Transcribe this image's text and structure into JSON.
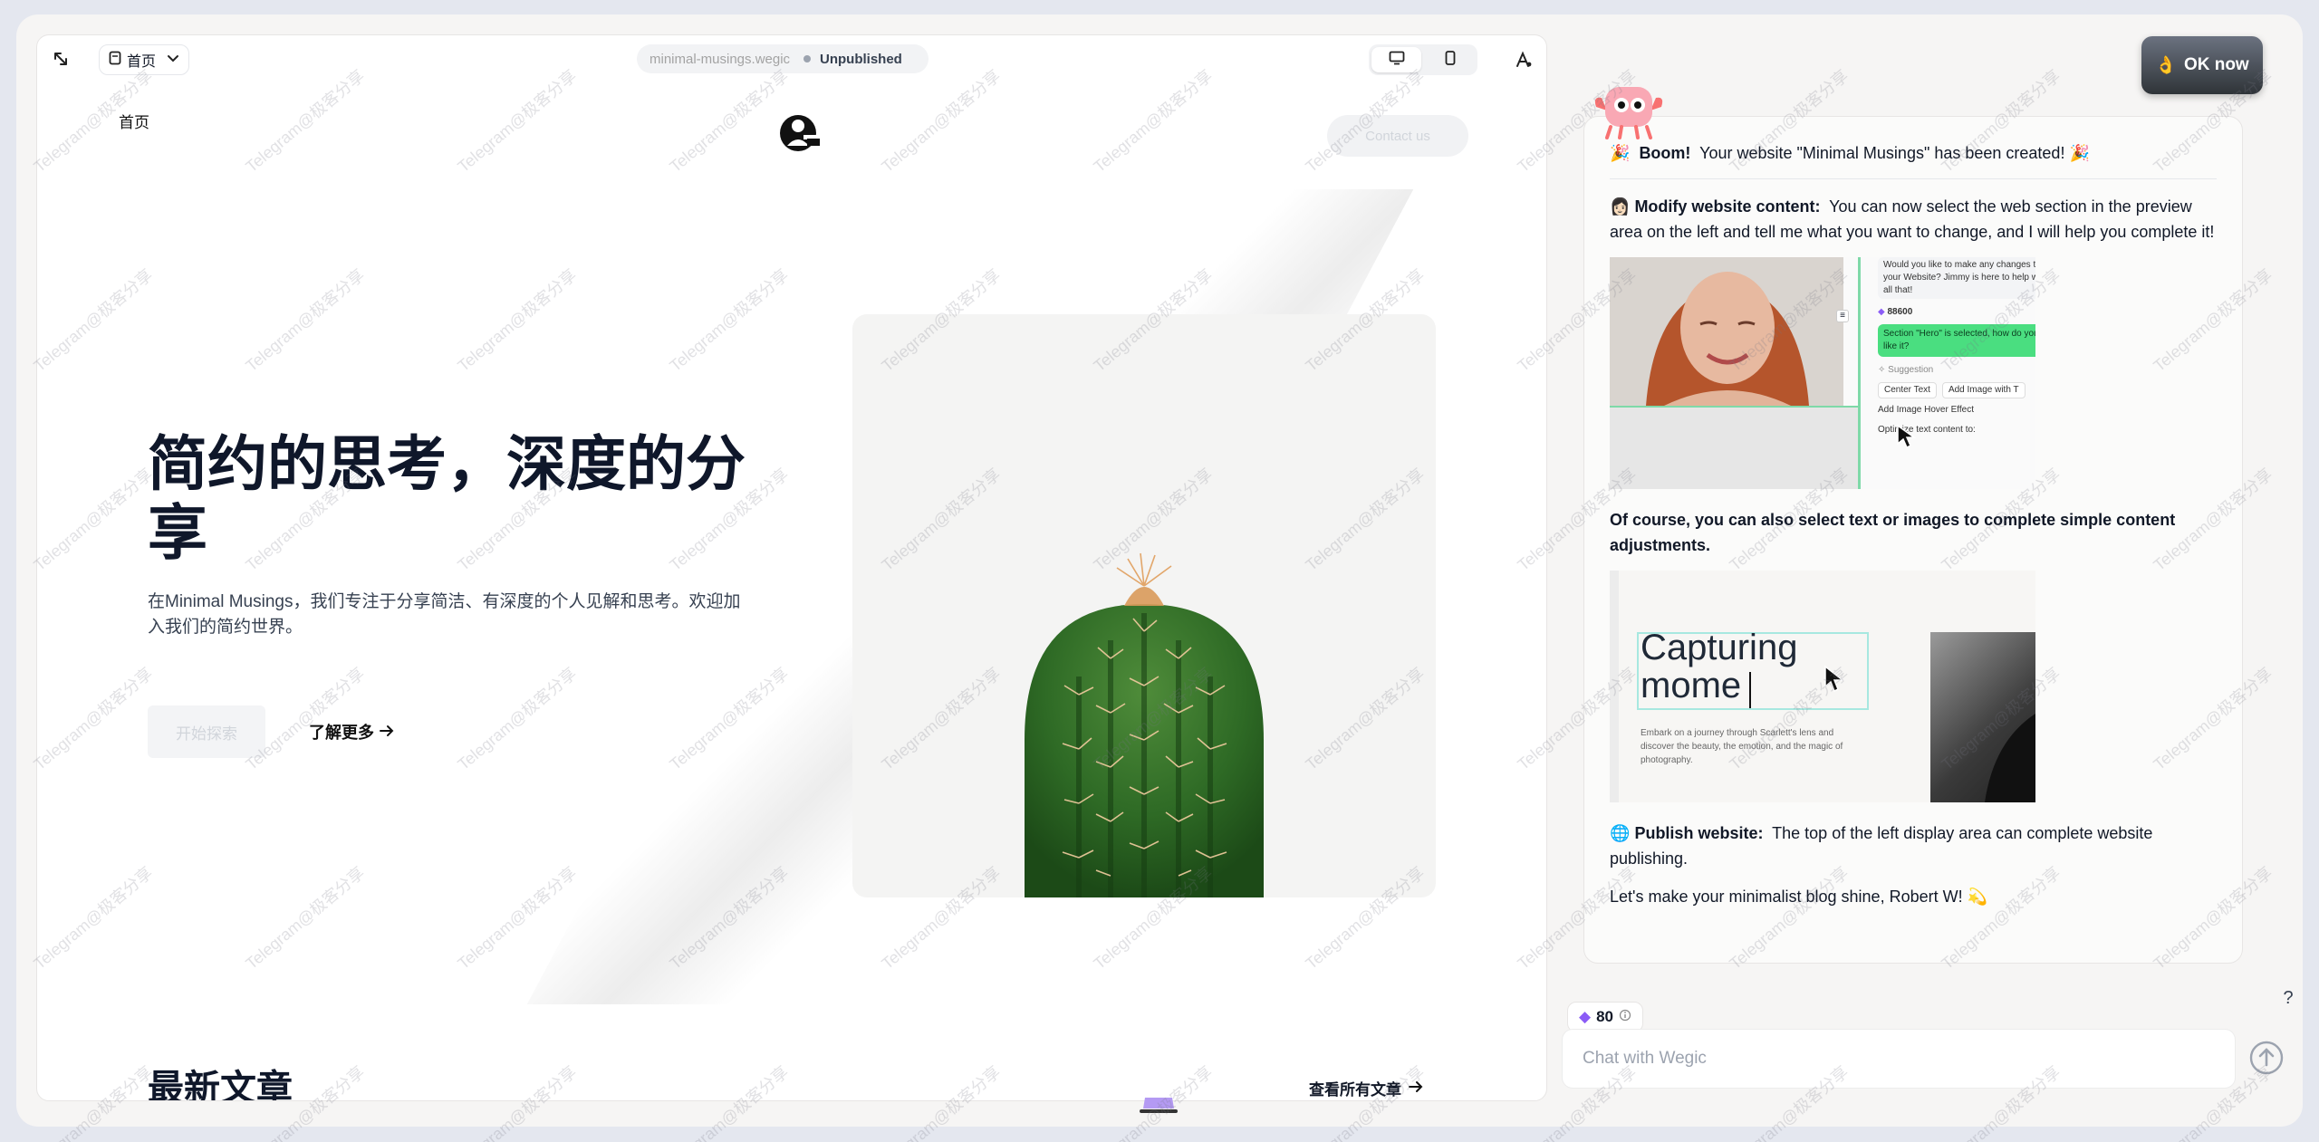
{
  "preview": {
    "page_select_label": "首页",
    "url": "minimal-musings.wegic",
    "status": "Unpublished"
  },
  "site": {
    "nav_home": "首页",
    "cta_label": "Contact us",
    "hero_title": "简约的思考，深度的分享",
    "hero_subtitle": "在Minimal Musings，我们专注于分享简洁、有深度的个人见解和思考。欢迎加入我们的简约世界。",
    "hero_start": "开始探索",
    "hero_more": "了解更多",
    "latest_title": "最新文章",
    "view_all": "查看所有文章"
  },
  "chat": {
    "ok_now": "OK now",
    "boom_bold": "Boom!",
    "boom_text": "Your website \"Minimal Musings\" has been created!",
    "modify_bold": "Modify website content:",
    "modify_text": "You can now select the web section in the preview area on the left and tell me what you want to change, and I will help you complete it!",
    "demo1": {
      "bubble_text": "Would you like to make any changes to your Website? Jimmy is here to help with all that!",
      "credits": "88600",
      "selected_text": "Section \"Hero\" is selected, how do you like it?",
      "suggestion_label": "Suggestion",
      "chips": [
        "Center Text",
        "Add Image with T",
        "Add Image Hover Effect",
        "Optimize text content to:"
      ]
    },
    "course_text": "Of course, you can also select text or images to complete simple content adjustments.",
    "demo2": {
      "heading": "Capturing mome",
      "paragraph": "Embark on a journey through Scarlett's lens and discover the beauty, the emotion, and the magic of photography."
    },
    "publish_bold": "Publish website:",
    "publish_text": "The top of the left display area can complete website publishing.",
    "closing_text": "Let's make your minimalist blog shine, Robert W!",
    "credits": "80",
    "input_placeholder": "Chat with Wegic",
    "help": "?"
  },
  "watermark": "Telegram@极客分享",
  "colors": {
    "accent_green": "#3ddc84",
    "cta_gray": "#f1f2f4",
    "dark_text": "#0f172a"
  }
}
